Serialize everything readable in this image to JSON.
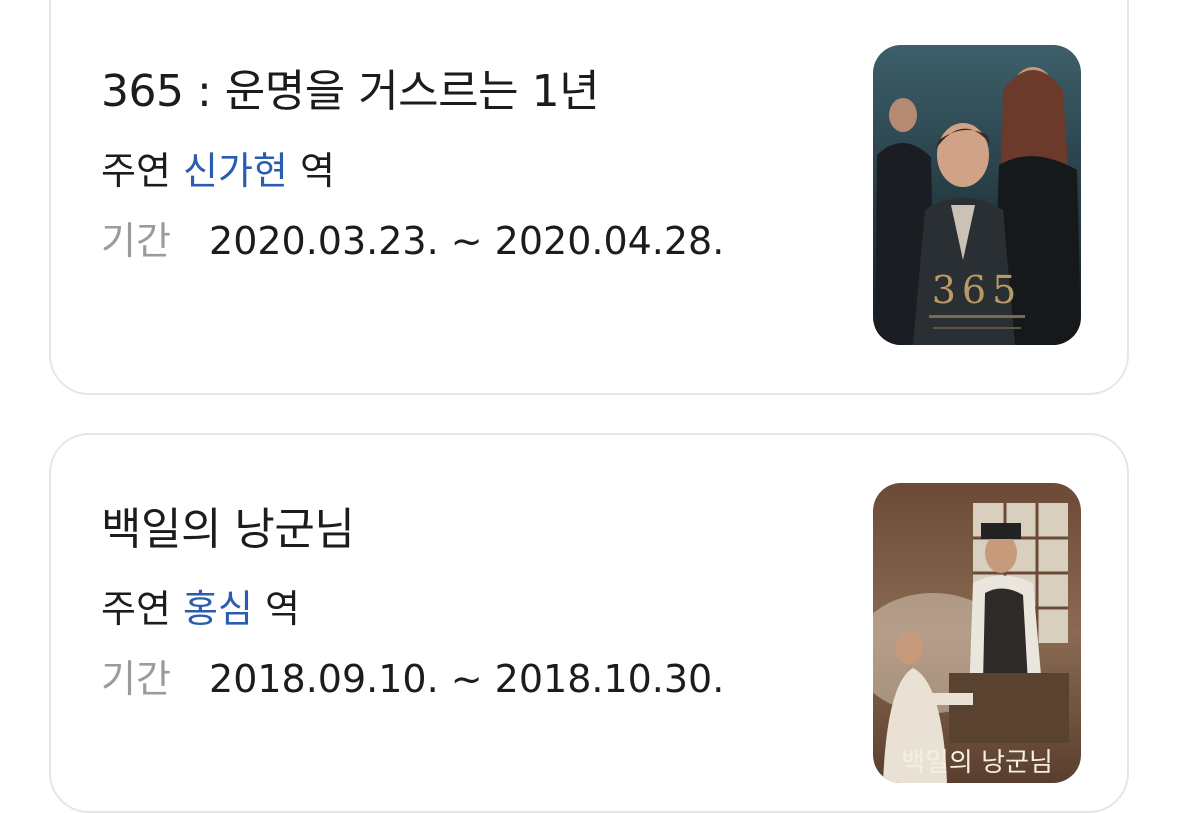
{
  "works": [
    {
      "title": "365 : 운명을 거스르는 1년",
      "role_label": "주연",
      "role_name": "신가현",
      "role_suffix": "역",
      "period_label": "기간",
      "period_value": "2020.03.23. ~ 2020.04.28.",
      "poster_text": "365",
      "poster_icon": "poster-365-icon"
    },
    {
      "title": "백일의 낭군님",
      "role_label": "주연",
      "role_name": "홍심",
      "role_suffix": "역",
      "period_label": "기간",
      "period_value": "2018.09.10. ~ 2018.10.30.",
      "poster_text": "백일의 낭군님",
      "poster_icon": "poster-100days-icon"
    }
  ],
  "colors": {
    "link": "#2a5db0",
    "label_gray": "#9a9a9f",
    "text": "#1c1c1e",
    "card_border": "#e6e6e9"
  }
}
